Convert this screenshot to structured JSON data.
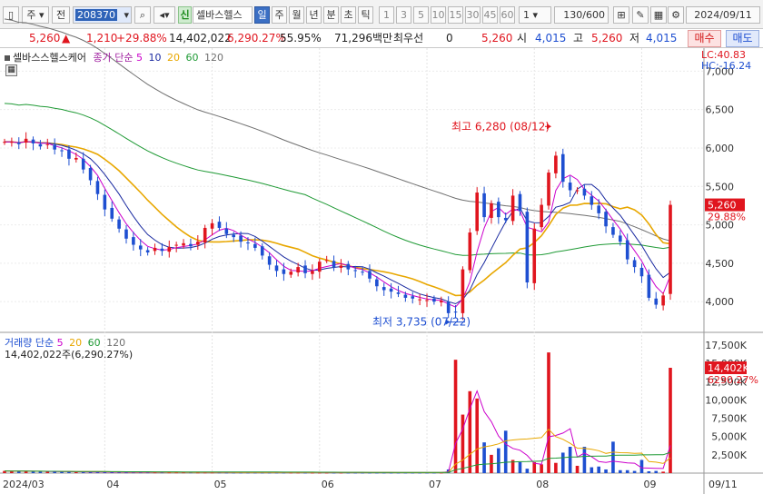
{
  "toolbar": {
    "market": "주",
    "prefix": "전",
    "code": "208370",
    "new_badge": "신",
    "stock_name": "셀바스헬스",
    "periods": [
      "일",
      "주",
      "월",
      "년",
      "분",
      "초",
      "틱"
    ],
    "selected_period": "일",
    "intervals": [
      "1",
      "3",
      "5",
      "10",
      "15",
      "30",
      "45",
      "60"
    ],
    "interval_value": "1",
    "count": "130/600",
    "date": "2024/09/11"
  },
  "quote": {
    "price": "5,260",
    "arrow": "▲",
    "change": "1,210",
    "change_pct": "+29.88%",
    "volume": "14,402,022",
    "volume_pct": "6,290.27%",
    "turnover": "55.95%",
    "amount": "71,296백만",
    "best_label": "최우선",
    "best_value": "0",
    "best_price": "5,260",
    "open_label": "시",
    "open": "4,015",
    "high_label": "고",
    "high": "5,260",
    "low_label": "저",
    "low": "4,015",
    "buy_label": "매수",
    "sell_label": "매도"
  },
  "price_panel": {
    "legend_name": "셀바스스헬스케어",
    "legend_ma_label": "종가 단순",
    "ma_periods": [
      "5",
      "10",
      "20",
      "60",
      "120"
    ],
    "lc": "LC:40.83",
    "hc": "HC:-16.24",
    "yticks": [
      "7,000",
      "6,500",
      "6,000",
      "5,500",
      "5,000",
      "4,500",
      "4,000"
    ],
    "price_tag": "5,260",
    "pct_tag": "29.88%",
    "high_annot": "최고 6,280 (08/12)",
    "low_annot": "최저 3,735 (07/22)"
  },
  "volume_panel": {
    "legend_label": "거래량 단순",
    "ma_periods": [
      "5",
      "20",
      "60",
      "120"
    ],
    "current_text": "14,402,022주(6,290.27%)",
    "yticks": [
      "17,500K",
      "15,000K",
      "12,500K",
      "10,000K",
      "7,500K",
      "5,000K",
      "2,500K"
    ],
    "vol_tag": "14,402K",
    "pct_tag": "6290.27%"
  },
  "x_axis": {
    "labels": [
      "2024/03",
      "04",
      "05",
      "06",
      "07",
      "08",
      "09",
      "09/11"
    ]
  },
  "colors": {
    "up": "#e0151e",
    "down": "#1e4fd1",
    "ma5": "#cc00cc",
    "ma10": "#1a2aa0",
    "ma20": "#e8a700",
    "ma60": "#1f9a35",
    "ma120": "#707070"
  },
  "chart_data": {
    "type": "candlestick",
    "x_labels": [
      "2024/03",
      "04",
      "05",
      "06",
      "07",
      "08",
      "09"
    ],
    "ylim": [
      3600,
      7300
    ],
    "max": {
      "price": 6280,
      "date": "08/12"
    },
    "min": {
      "price": 3735,
      "date": "07/22"
    },
    "last": {
      "open": 4015,
      "high": 5260,
      "low": 4015,
      "close": 5260,
      "volume": 14402022
    },
    "close_path": [
      6080,
      6080,
      6050,
      6120,
      6060,
      6020,
      6050,
      5980,
      5960,
      5860,
      5870,
      5720,
      5580,
      5400,
      5200,
      5080,
      4950,
      4820,
      4740,
      4680,
      4640,
      4700,
      4660,
      4710,
      4740,
      4760,
      4720,
      4780,
      4960,
      5020,
      4960,
      4880,
      4840,
      4780,
      4760,
      4700,
      4600,
      4480,
      4400,
      4360,
      4390,
      4450,
      4370,
      4400,
      4520,
      4540,
      4450,
      4470,
      4420,
      4400,
      4380,
      4300,
      4200,
      4150,
      4130,
      4100,
      4050,
      4040,
      4030,
      4020,
      4000,
      4010,
      3850,
      3860,
      4420,
      4900,
      5420,
      5100,
      5280,
      5100,
      5060,
      5380,
      5180,
      4250,
      4950,
      5260,
      5680,
      5900,
      5560,
      5450,
      5450,
      5380,
      5260,
      5150,
      4980,
      4870,
      4780,
      4550,
      4450,
      4330,
      4050,
      3960,
      4080,
      5260
    ],
    "volume_path_k": [
      300,
      250,
      280,
      260,
      240,
      220,
      210,
      200,
      190,
      180,
      170,
      160,
      150,
      150,
      140,
      130,
      120,
      110,
      110,
      110,
      110,
      110,
      110,
      110,
      110,
      110,
      110,
      100,
      100,
      100,
      100,
      90,
      90,
      90,
      90,
      90,
      90,
      90,
      90,
      90,
      90,
      90,
      80,
      80,
      80,
      80,
      80,
      80,
      80,
      80,
      80,
      80,
      80,
      80,
      80,
      80,
      80,
      80,
      80,
      80,
      80,
      80,
      500,
      15500,
      8000,
      11200,
      10200,
      4200,
      2500,
      3400,
      5800,
      1800,
      1500,
      600,
      1500,
      1200,
      16500,
      1400,
      2800,
      3600,
      1000,
      3600,
      800,
      900,
      500,
      4300,
      400,
      400,
      300,
      1800,
      250,
      300,
      200,
      14402
    ]
  }
}
